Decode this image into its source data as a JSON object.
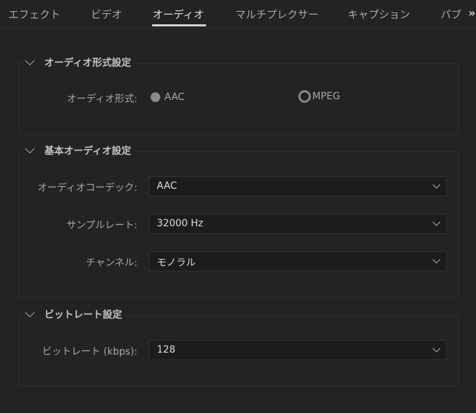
{
  "tabs": [
    {
      "label": "エフェクト"
    },
    {
      "label": "ビデオ"
    },
    {
      "label": "オーディオ"
    },
    {
      "label": "マルチプレクサー"
    },
    {
      "label": "キャプション"
    },
    {
      "label": "パブ"
    }
  ],
  "tabs_overflow": "»",
  "active_tab": "オーディオ",
  "audio_format_section": {
    "title": "オーディオ形式設定",
    "format_label": "オーディオ形式:",
    "options": [
      {
        "label": "AAC",
        "selected": true
      },
      {
        "label": "MPEG",
        "selected": false
      }
    ]
  },
  "basic_audio_section": {
    "title": "基本オーディオ設定",
    "codec_label": "オーディオコーデック:",
    "codec_value": "AAC",
    "sample_rate_label": "サンプルレート:",
    "sample_rate_value": "32000 Hz",
    "channels_label": "チャンネル:",
    "channels_value": "モノラル"
  },
  "bitrate_section": {
    "title": "ビットレート設定",
    "bitrate_label": "ビットレート (kbps):",
    "bitrate_value": "128"
  },
  "colors": {
    "background": "#232323",
    "active_tab_underline": "#d4d4d4"
  }
}
